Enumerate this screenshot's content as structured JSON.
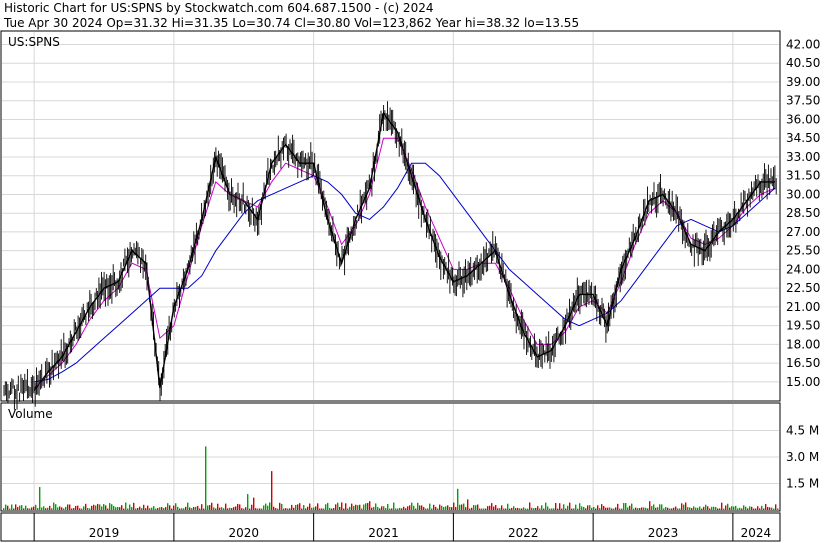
{
  "header": {
    "line1": "Historic Chart for US:SPNS by Stockwatch.com 604.687.1500 - (c) 2024",
    "line2": "Tue Apr 30 2024   Op=31.32   Hi=31.35   Lo=30.74   Cl=30.80   Vol=123,862   Year hi=38.32   lo=13.55"
  },
  "chart_data": [
    {
      "type": "line",
      "title": "US:SPNS",
      "ylim": [
        13.55,
        43.0
      ],
      "yticks": [
        "42.00",
        "40.50",
        "39.00",
        "37.50",
        "36.00",
        "34.50",
        "33.00",
        "31.50",
        "30.00",
        "28.50",
        "27.00",
        "25.50",
        "24.00",
        "22.50",
        "21.00",
        "19.50",
        "18.00",
        "16.50",
        "15.00"
      ],
      "ytick_values": [
        42.0,
        40.5,
        39.0,
        37.5,
        36.0,
        34.5,
        33.0,
        31.5,
        30.0,
        28.5,
        27.0,
        25.5,
        24.0,
        22.5,
        21.0,
        19.5,
        18.0,
        16.5,
        15.0
      ],
      "x": [
        2019.0,
        2019.1,
        2019.2,
        2019.3,
        2019.4,
        2019.5,
        2019.6,
        2019.7,
        2019.8,
        2019.9,
        2020.0,
        2020.1,
        2020.2,
        2020.3,
        2020.4,
        2020.5,
        2020.6,
        2020.7,
        2020.8,
        2020.9,
        2021.0,
        2021.1,
        2021.2,
        2021.3,
        2021.4,
        2021.5,
        2021.6,
        2021.7,
        2021.8,
        2021.9,
        2022.0,
        2022.1,
        2022.2,
        2022.3,
        2022.4,
        2022.5,
        2022.6,
        2022.7,
        2022.8,
        2022.9,
        2023.0,
        2023.1,
        2023.2,
        2023.3,
        2023.4,
        2023.5,
        2023.6,
        2023.7,
        2023.8,
        2023.9,
        2024.0,
        2024.1,
        2024.2,
        2024.3
      ],
      "series": [
        {
          "values": [
            14.3,
            15.8,
            17.0,
            19.0,
            21.0,
            22.5,
            23.0,
            25.5,
            24.5,
            14.5,
            21.0,
            24.0,
            28.0,
            33.0,
            30.0,
            29.5,
            28.0,
            32.5,
            34.0,
            32.5,
            32.5,
            28.0,
            24.5,
            28.0,
            30.5,
            36.5,
            35.0,
            31.5,
            28.0,
            25.0,
            23.0,
            23.5,
            24.5,
            25.5,
            22.0,
            19.0,
            17.0,
            17.5,
            19.5,
            22.0,
            22.0,
            19.5,
            24.0,
            26.5,
            29.5,
            30.0,
            28.5,
            26.0,
            25.5,
            27.0,
            28.0,
            29.5,
            31.0,
            31.0
          ]
        },
        {
          "values": [
            14.5,
            15.5,
            16.5,
            18.0,
            20.0,
            21.5,
            22.5,
            24.5,
            24.0,
            18.5,
            19.5,
            23.5,
            27.5,
            31.0,
            30.0,
            29.5,
            29.0,
            31.0,
            32.5,
            32.0,
            31.5,
            29.0,
            26.0,
            27.5,
            30.0,
            34.5,
            34.5,
            32.0,
            29.0,
            26.5,
            24.0,
            24.0,
            24.5,
            24.5,
            22.5,
            20.0,
            18.0,
            18.0,
            19.0,
            21.0,
            21.5,
            20.5,
            23.0,
            26.0,
            28.5,
            29.5,
            28.5,
            26.5,
            26.0,
            26.5,
            27.5,
            29.0,
            30.0,
            30.5
          ]
        },
        {
          "values": [
            15.0,
            15.2,
            15.8,
            16.5,
            17.5,
            18.5,
            19.5,
            20.5,
            21.5,
            22.5,
            22.5,
            22.5,
            23.5,
            25.5,
            27.0,
            28.5,
            29.5,
            30.0,
            30.5,
            31.0,
            31.5,
            31.0,
            30.0,
            28.5,
            28.0,
            29.0,
            30.5,
            32.5,
            32.5,
            31.5,
            30.0,
            28.5,
            27.0,
            25.5,
            24.0,
            23.0,
            22.0,
            21.0,
            20.0,
            19.5,
            20.0,
            20.5,
            21.5,
            23.0,
            24.5,
            26.0,
            27.5,
            28.0,
            27.5,
            27.0,
            27.5,
            28.5,
            29.5,
            30.5
          ]
        }
      ],
      "series_colors": [
        "#000000",
        "#cc00cc",
        "#0000cc"
      ]
    },
    {
      "type": "bar",
      "title": "Volume",
      "ylim": [
        0,
        6000000
      ],
      "yticks": [
        "4.5 M",
        "3.0 M",
        "1.5 M"
      ],
      "ytick_values": [
        4500000,
        3000000,
        1500000
      ],
      "volume_seed": 77
    }
  ],
  "x_axis": {
    "labels": [
      "2019",
      "2020",
      "2021",
      "2022",
      "2023",
      "2024"
    ],
    "values": [
      2019,
      2020,
      2021,
      2022,
      2023,
      2024
    ],
    "xlim": [
      2018.77,
      2024.33
    ]
  }
}
